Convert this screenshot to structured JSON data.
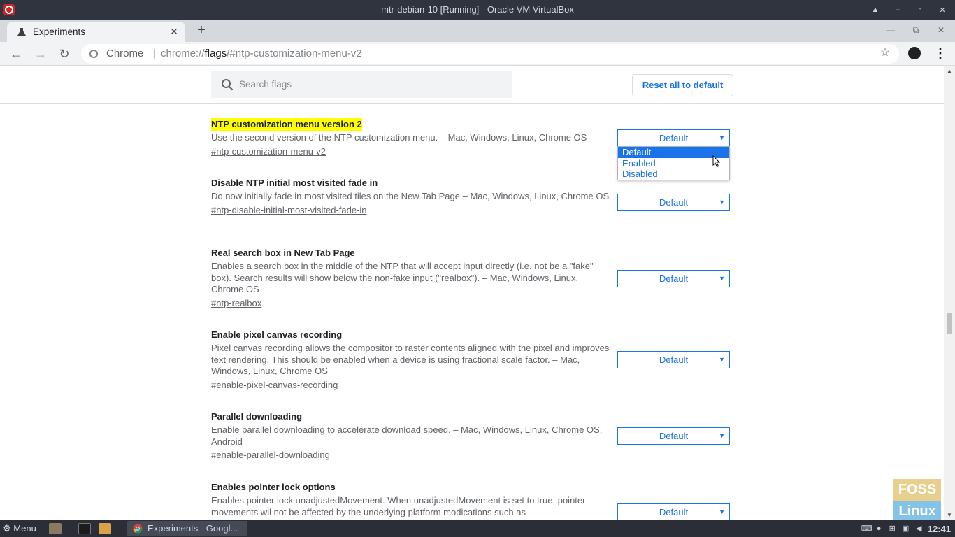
{
  "window": {
    "title": "mtr-debian-10 [Running] - Oracle VM VirtualBox",
    "controls": [
      "▲",
      "–",
      "◦",
      "✕"
    ]
  },
  "browser": {
    "tab": {
      "title": "Experiments",
      "close": "✕"
    },
    "new_tab": "+",
    "window_controls": {
      "minimize": "—",
      "restore": "⧉",
      "close": "✕"
    },
    "nav": {
      "back": "←",
      "forward": "→",
      "reload": "↻"
    },
    "omnibox": {
      "origin_label": "Chrome",
      "url_scheme": "chrome://",
      "url_host": "flags",
      "url_rest": "/#ntp-customization-menu-v2"
    },
    "star": "☆",
    "menu": "⋮"
  },
  "page": {
    "search_placeholder": "Search flags",
    "reset_label": "Reset all to default",
    "experiments": [
      {
        "title": "NTP customization menu version 2",
        "description": "Use the second version of the NTP customization menu. – Mac, Windows, Linux, Chrome OS",
        "link": "#ntp-customization-menu-v2",
        "value": "Default"
      },
      {
        "title": "Disable NTP initial most visited fade in",
        "description": "Do now initially fade in most visited tiles on the New Tab Page – Mac, Windows, Linux, Chrome OS",
        "link": "#ntp-disable-initial-most-visited-fade-in",
        "value": "Default"
      },
      {
        "title": "Real search box in New Tab Page",
        "description": "Enables a search box in the middle of the NTP that will accept input directly (i.e. not be a \"fake\" box). Search results will show below the non-fake input (\"realbox\"). – Mac, Windows, Linux, Chrome OS",
        "link": "#ntp-realbox",
        "value": "Default"
      },
      {
        "title": "Enable pixel canvas recording",
        "description": "Pixel canvas recording allows the compositor to raster contents aligned with the pixel and improves text rendering. This should be enabled when a device is using fractional scale factor. – Mac, Windows, Linux, Chrome OS",
        "link": "#enable-pixel-canvas-recording",
        "value": "Default"
      },
      {
        "title": "Parallel downloading",
        "description": "Enable parallel downloading to accelerate download speed. – Mac, Windows, Linux, Chrome OS, Android",
        "link": "#enable-parallel-downloading",
        "value": "Default"
      },
      {
        "title": "Enables pointer lock options",
        "description": "Enables pointer lock unadjustedMovement. When unadjustedMovement is set to true, pointer movements wil not be affected by the underlying platform modications such as",
        "link": "",
        "value": "Default"
      }
    ],
    "dropdown_options": [
      "Default",
      "Enabled",
      "Disabled"
    ],
    "dropdown_selected": "Default"
  },
  "watermark": {
    "top": "FOSS",
    "bottom": "Linux"
  },
  "taskbar": {
    "menu_label": "Menu",
    "task_label": "Experiments - Googl...",
    "clock": "12:41"
  },
  "colors": {
    "accent": "#1a73e8",
    "highlight": "#ffff00",
    "titlebar": "#2f343f",
    "taskbar": "#2b2e37"
  }
}
